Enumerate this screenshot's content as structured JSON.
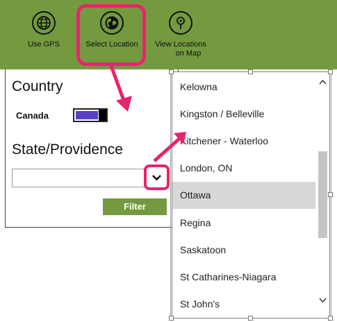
{
  "toolbar": {
    "use_gps": {
      "label": "Use GPS",
      "icon": "globe-icon"
    },
    "select_location": {
      "label": "Select Location",
      "icon": "location-globe-icon"
    },
    "view_map": {
      "label_line1": "View Locations",
      "label_line2": "on Map",
      "icon": "map-pin-icon"
    }
  },
  "country": {
    "heading": "Country",
    "label": "Canada",
    "toggle_on": true
  },
  "state": {
    "heading": "State/Providence",
    "value": ""
  },
  "filter": {
    "label": "Filter"
  },
  "dropdown": {
    "items": [
      "Kelowna",
      "Kingston / Belleville",
      "Kitchener - Waterloo",
      "London, ON",
      "Ottawa",
      "Regina",
      "Saskatoon",
      "St Catharines-Niagara",
      "St John's"
    ],
    "selected": "Ottawa"
  },
  "colors": {
    "toolbar_green": "#739a3e",
    "highlight_pink": "#e8246e",
    "toggle_purple": "#5a3fc8",
    "selected_row": "#d8d8d8"
  }
}
